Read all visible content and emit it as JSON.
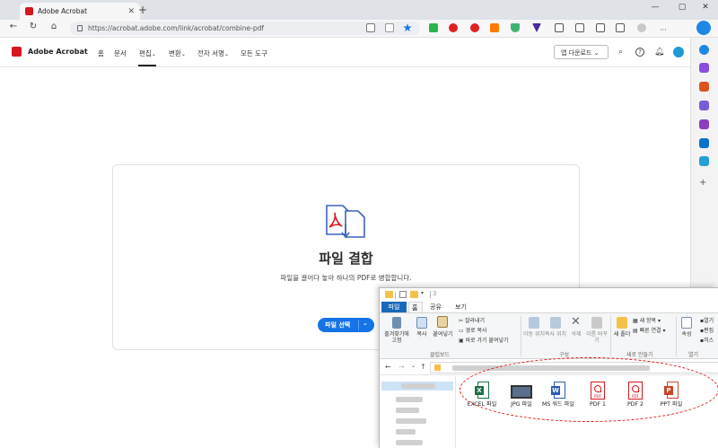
{
  "browser": {
    "tab_title": "Adobe Acrobat",
    "tab_close": "✕",
    "new_tab": "+",
    "url": "https://acrobat.adobe.com/link/acrobat/combine-pdf",
    "window_controls": [
      "—",
      "▢",
      "✕"
    ],
    "nav": {
      "back": "←",
      "refresh": "↻",
      "home": "⌂"
    }
  },
  "acrobat": {
    "app_name": "Adobe Acrobat",
    "nav_items": [
      "홈",
      "문서",
      "편집",
      "변환",
      "전자 서명",
      "모든 도구"
    ],
    "nav_chevrons": [
      "",
      "",
      "⌄",
      "⌄",
      "⌄",
      ""
    ],
    "app_download": "앱 다운로드 ⌄",
    "brand_color": "#d7161e",
    "accent_color": "#1473e6"
  },
  "combine": {
    "heading": "파일 결합",
    "subtitle": "파일을 끌어다 놓아 하나의 PDF로 병합합니다.",
    "select_button": "파일 선택",
    "select_chevron": "⌄"
  },
  "explorer": {
    "qat_title": "3",
    "tabs": {
      "file": "파일",
      "home": "홈",
      "share": "공유",
      "view": "보기"
    },
    "clipboard": {
      "pin": "즐겨찾기에 고정",
      "copy": "복사",
      "paste": "붙여넣기",
      "cut": "잘라내기",
      "copy_path": "경로 복사",
      "paste_shortcut": "바로 가기 붙여넣기",
      "group": "클립보드"
    },
    "organize": {
      "move_to": "이동 위치",
      "copy_to": "복사 위치",
      "delete": "삭제",
      "rename": "이름 바꾸기",
      "group": "구성"
    },
    "new": {
      "new_folder": "새 폴더",
      "new_item": "새 항목",
      "quick_access": "빠른 연결",
      "group": "새로 만들기"
    },
    "open": {
      "properties": "속성",
      "open": "열기",
      "edit": "편집",
      "history": "히스",
      "group": "열기"
    },
    "path_arrows": {
      "back": "←",
      "forward": "→",
      "down": "⌄",
      "up": "↑"
    },
    "files": [
      {
        "label": "EXCEL 파일",
        "icon": "excel-icon",
        "color": "#1d7044"
      },
      {
        "label": "JPG 파일",
        "icon": "image-icon",
        "color": "#5a6f8c"
      },
      {
        "label": "MS 워드 파일",
        "icon": "word-icon",
        "color": "#2b5bb5"
      },
      {
        "label": "PDF 1",
        "icon": "pdf-icon",
        "color": "#d7161e"
      },
      {
        "label": "PDF 2",
        "icon": "pdf-icon",
        "color": "#d7161e"
      },
      {
        "label": "PPT 파일",
        "icon": "ppt-icon",
        "color": "#c8462a"
      }
    ]
  }
}
